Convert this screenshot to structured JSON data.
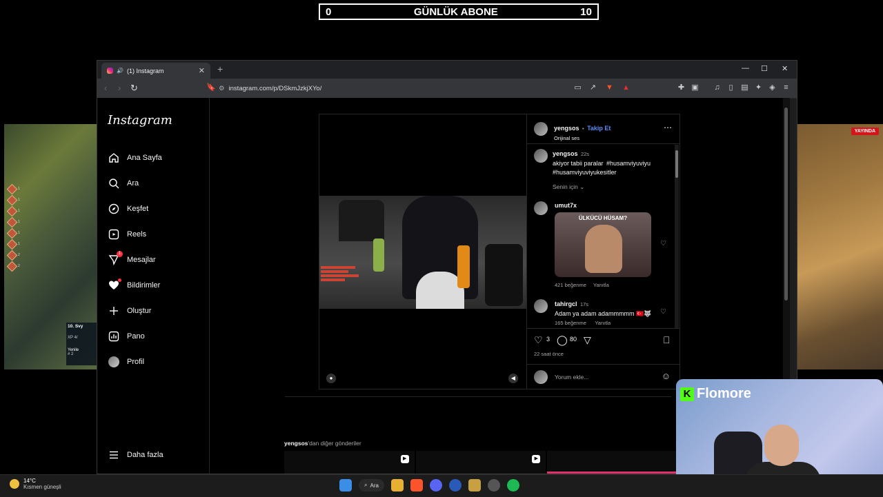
{
  "counter": {
    "left": "0",
    "title": "GÜNLÜK ABONE",
    "right": "10"
  },
  "game_right": {
    "live_badge": "YAYINDA"
  },
  "game_left": {
    "level": "10. Svy",
    "xp": "XP 4/",
    "refresh": "Yenile",
    "refresh_cost": "# 2"
  },
  "browser": {
    "tab_title": "(1) Instagram",
    "url": "instagram.com/p/DSkmJzkjXYo/"
  },
  "instagram": {
    "logo": "Instagram",
    "nav": [
      {
        "label": "Ana Sayfa",
        "icon": "home-icon"
      },
      {
        "label": "Ara",
        "icon": "search-icon"
      },
      {
        "label": "Keşfet",
        "icon": "compass-icon"
      },
      {
        "label": "Reels",
        "icon": "reels-icon"
      },
      {
        "label": "Mesajlar",
        "icon": "messenger-icon",
        "badge": "1"
      },
      {
        "label": "Bildirimler",
        "icon": "heart-icon"
      },
      {
        "label": "Oluştur",
        "icon": "plus-icon"
      },
      {
        "label": "Pano",
        "icon": "dashboard-icon"
      },
      {
        "label": "Profil",
        "icon": "avatar"
      }
    ],
    "more": "Daha fazla",
    "post": {
      "author": "yengsos",
      "separator": "•",
      "follow": "Takip Et",
      "audio": "Orijinal ses",
      "caption_user": "yengsos",
      "caption_time": "22s",
      "caption_text": "akiyor tabii paralar",
      "hashtag1": "#husamviyuviyu",
      "hashtag2": "#husamviyuviyukesitler",
      "for_you": "Senin için",
      "comments": [
        {
          "user": "umut7x",
          "image_caption": "ÜLKÜCÜ HÜSAM?",
          "likes": "421 beğenme",
          "reply": "Yanıtla"
        },
        {
          "user": "tahirgcl",
          "time": "17s",
          "text": "Adam ya adam adammmmm 🇹🇷🐺",
          "likes": "165 beğenme",
          "reply": "Yanıtla"
        }
      ],
      "like_count": "3",
      "comment_count": "80",
      "posted": "22 saat önce",
      "add_comment_placeholder": "Yorum ekle..."
    },
    "more_posts_user": "yengsos",
    "more_posts_suffix": "'dan diğer gönderiler"
  },
  "webcam": {
    "brand": "Flomore"
  },
  "taskbar": {
    "temperature": "14°C",
    "condition": "Kısmen güneşli",
    "search": "Ara"
  }
}
